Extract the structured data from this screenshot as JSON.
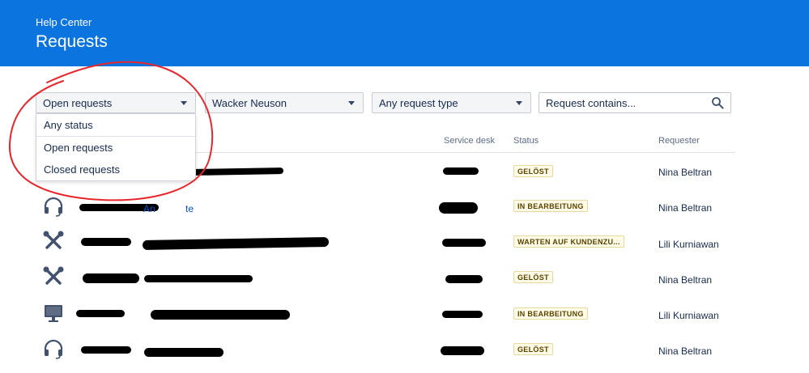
{
  "header": {
    "breadcrumb": "Help Center",
    "title": "Requests"
  },
  "filters": {
    "status": "Open requests",
    "organization": "Wacker Neuson",
    "request_type": "Any request type",
    "search_placeholder": "Request contains..."
  },
  "status_dropdown": {
    "options": [
      "Any status",
      "Open requests",
      "Closed requests"
    ]
  },
  "table": {
    "columns": {
      "service_desk": "Service desk",
      "status": "Status",
      "requester": "Requester"
    },
    "rows": [
      {
        "icon": "none",
        "link": "",
        "status": "GELÖST",
        "requester": "Nina Beltran"
      },
      {
        "icon": "headset-icon",
        "link": "An",
        "link2": "te",
        "status": "IN BEARBEITUNG",
        "requester": "Nina Beltran"
      },
      {
        "icon": "tools-icon",
        "link": "",
        "status": "WARTEN AUF KUNDENZU...",
        "requester": "Lili Kurniawan"
      },
      {
        "icon": "tools-icon",
        "link": "",
        "status": "GELÖST",
        "requester": "Nina Beltran"
      },
      {
        "icon": "monitor-icon",
        "link": "",
        "status": "IN BEARBEITUNG",
        "requester": "Lili Kurniawan"
      },
      {
        "icon": "headset-icon",
        "link": "",
        "status": "GELÖST",
        "requester": "Nina Beltran"
      }
    ]
  },
  "colors": {
    "header": "#0c74df",
    "annotation": "#e8262b",
    "link": "#0052cc",
    "status_bg": "#fffbe6"
  }
}
